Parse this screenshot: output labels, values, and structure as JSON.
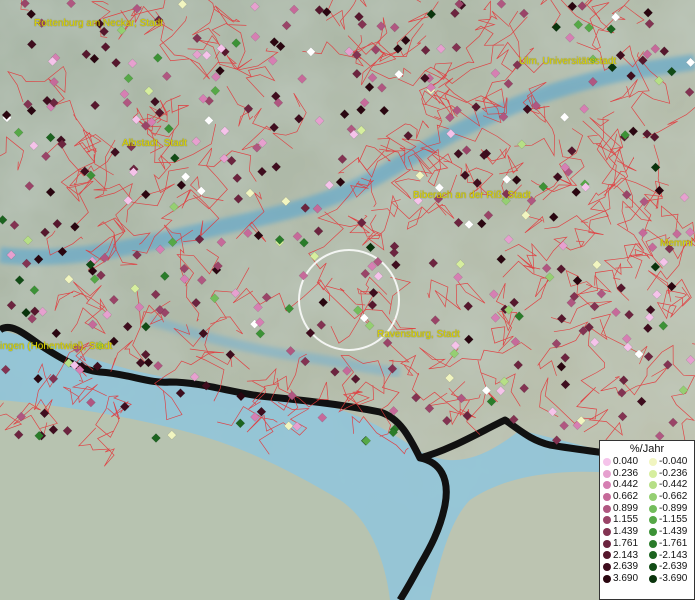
{
  "cities": [
    {
      "name": "Rottenburg am Neckar, Stadt"
    },
    {
      "name": "Ulm, Universitätsstadt"
    },
    {
      "name": "Albstadt, Stadt"
    },
    {
      "name": "Biberach an der Riß, Stadt"
    },
    {
      "name": "Memmi"
    },
    {
      "name": "Ravensburg, Stadt"
    },
    {
      "name": "ingen (Hohentwiel), Stadt"
    }
  ],
  "legend": {
    "title": "%/Jahr",
    "rows": [
      {
        "pos": "0.040",
        "neg": "-0.040",
        "pos_color": "#f5c3ea",
        "neg_color": "#f1f5c0"
      },
      {
        "pos": "0.236",
        "neg": "-0.236",
        "pos_color": "#e6a0cf",
        "neg_color": "#d6ee9e"
      },
      {
        "pos": "0.442",
        "neg": "-0.442",
        "pos_color": "#d67fb3",
        "neg_color": "#b6df86"
      },
      {
        "pos": "0.662",
        "neg": "-0.662",
        "pos_color": "#c66a9a",
        "neg_color": "#95cf72"
      },
      {
        "pos": "0.899",
        "neg": "-0.899",
        "pos_color": "#b05781",
        "neg_color": "#74bd5c"
      },
      {
        "pos": "1.155",
        "neg": "-1.155",
        "pos_color": "#9a4468",
        "neg_color": "#56a847"
      },
      {
        "pos": "1.439",
        "neg": "-1.439",
        "pos_color": "#833352",
        "neg_color": "#3c9236"
      },
      {
        "pos": "1.761",
        "neg": "-1.761",
        "pos_color": "#6c243f",
        "neg_color": "#2a7c2a"
      },
      {
        "pos": "2.143",
        "neg": "-2.143",
        "pos_color": "#56172d",
        "neg_color": "#1c6420"
      },
      {
        "pos": "2.639",
        "neg": "-2.639",
        "pos_color": "#3f0d1e",
        "neg_color": "#124c16"
      },
      {
        "pos": "3.690",
        "neg": "-3.690",
        "pos_color": "#2a0610",
        "neg_color": "#0a340c"
      }
    ]
  }
}
